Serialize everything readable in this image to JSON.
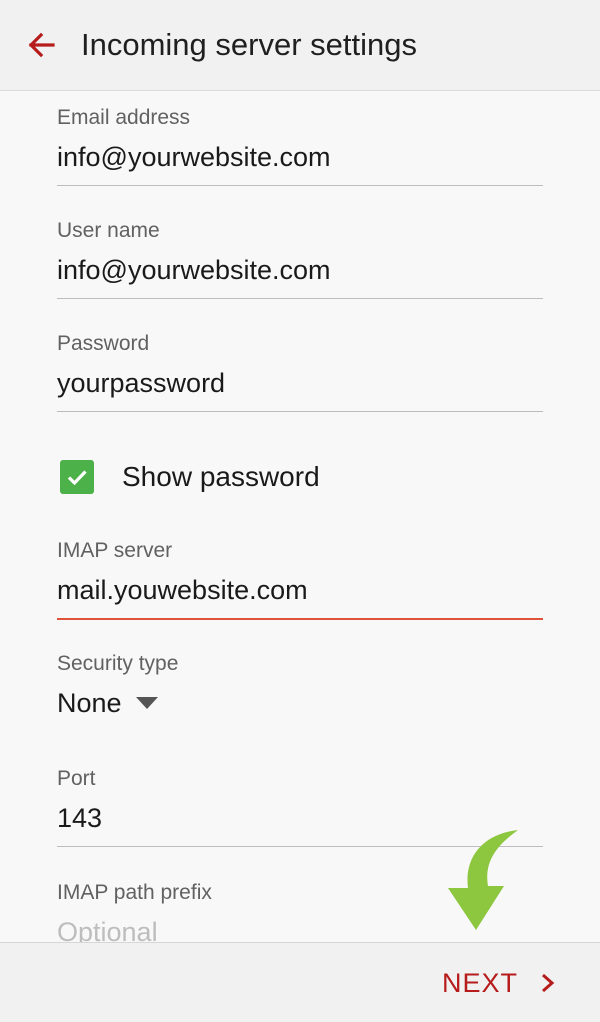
{
  "header": {
    "title": "Incoming server settings",
    "back_icon": "arrow-left-icon"
  },
  "form": {
    "email": {
      "label": "Email address",
      "value": "info@yourwebsite.com"
    },
    "username": {
      "label": "User name",
      "value": "info@yourwebsite.com"
    },
    "password": {
      "label": "Password",
      "value": "yourpassword"
    },
    "show_password": {
      "label": "Show password",
      "checked": true
    },
    "imap_server": {
      "label": "IMAP server",
      "value": "mail.youwebsite.com"
    },
    "security_type": {
      "label": "Security type",
      "value": "None"
    },
    "port": {
      "label": "Port",
      "value": "143"
    },
    "imap_path_prefix": {
      "label": "IMAP path prefix",
      "placeholder": "Optional"
    }
  },
  "footer": {
    "next_label": "NEXT"
  },
  "colors": {
    "accent": "#b71c1c",
    "checkbox": "#4db14a",
    "focus_underline": "#e0523a",
    "annotation_arrow": "#8dc63f"
  }
}
